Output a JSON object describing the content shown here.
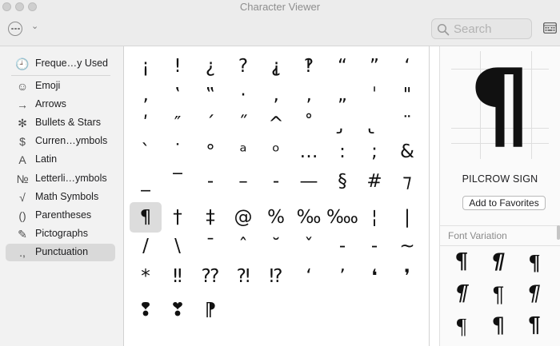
{
  "window": {
    "title": "Character Viewer"
  },
  "search": {
    "placeholder": "Search"
  },
  "sidebar": {
    "items": [
      {
        "label": "Freque…y Used",
        "icon": "clock-icon",
        "glyph": "🕘",
        "selected": false
      },
      {
        "label": "Emoji",
        "icon": "smiley-icon",
        "glyph": "☺",
        "selected": false
      },
      {
        "label": "Arrows",
        "icon": "arrow-icon",
        "glyph": "→",
        "selected": false
      },
      {
        "label": "Bullets & Stars",
        "icon": "asterisk-icon",
        "glyph": "✻",
        "selected": false
      },
      {
        "label": "Curren…ymbols",
        "icon": "dollar-icon",
        "glyph": "$",
        "selected": false
      },
      {
        "label": "Latin",
        "icon": "latin-a-icon",
        "glyph": "A",
        "selected": false
      },
      {
        "label": "Letterli…ymbols",
        "icon": "numero-icon",
        "glyph": "№",
        "selected": false
      },
      {
        "label": "Math Symbols",
        "icon": "square-root-icon",
        "glyph": "√",
        "selected": false
      },
      {
        "label": "Parentheses",
        "icon": "parentheses-icon",
        "glyph": "()",
        "selected": false
      },
      {
        "label": "Pictographs",
        "icon": "pictograph-icon",
        "glyph": "✎",
        "selected": false
      },
      {
        "label": "Punctuation",
        "icon": "punctuation-icon",
        "glyph": ".,",
        "selected": true
      }
    ]
  },
  "grid": {
    "rows": [
      [
        "¡",
        "!",
        "¿",
        "?",
        "⸘",
        "‽",
        "“",
        "”",
        "‘"
      ],
      [
        "‚",
        "‛",
        "‟",
        "·",
        "‚",
        "‚",
        "„",
        "ˈ",
        "\""
      ],
      [
        "ʹ",
        "″",
        "ˊ",
        "˝",
        "^",
        "˚",
        "̡",
        "̢",
        "¨"
      ],
      [
        "ˋ",
        "˙",
        "°",
        "ᵃ",
        "ᵒ",
        "…",
        ":",
        ";",
        "&"
      ],
      [
        "_",
        "‾",
        "-",
        "–",
        "‐",
        "—",
        "§",
        "#",
        "⁊"
      ],
      [
        "¶",
        "†",
        "‡",
        "@",
        "%",
        "‰",
        "‱",
        "¦",
        "|"
      ],
      [
        "/",
        "\\",
        "ˉ",
        "ˆ",
        "˘",
        "ˇ",
        "-",
        "‐",
        "~"
      ],
      [
        "*",
        "‼",
        "⁇",
        "⁈",
        "⁉",
        "ʻ",
        "ʼ",
        "❛",
        "❜"
      ],
      [
        "❢",
        "❣",
        "⁋",
        "",
        "",
        "",
        "",
        "",
        ""
      ]
    ],
    "selected_char": "¶"
  },
  "detail": {
    "glyph": "¶",
    "name": "PILCROW SIGN",
    "add_favorites_label": "Add to Favorites",
    "font_variation_label": "Font Variation",
    "variations": [
      "¶",
      "¶",
      "¶",
      "¶",
      "¶",
      "¶",
      "¶",
      "¶",
      "¶"
    ]
  }
}
